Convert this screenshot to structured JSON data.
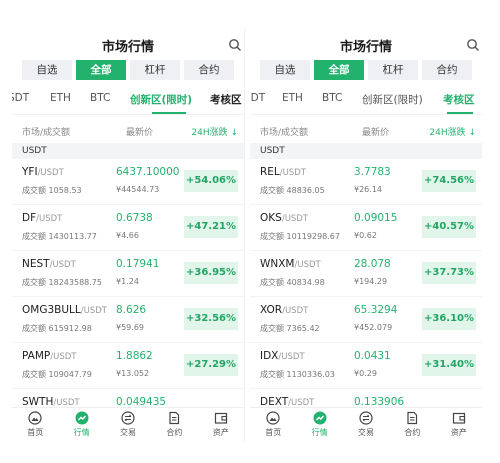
{
  "colors": {
    "accent": "#23b26d",
    "up_bg": "#e2f5ea",
    "up_text": "#23a566"
  },
  "left": {
    "title": "市场行情",
    "segments": [
      "自选",
      "全部",
      "杠杆",
      "合约"
    ],
    "active_segment": "全部",
    "subtabs": [
      "SDT",
      "ETH",
      "BTC",
      "创新区(限时)",
      "考核区"
    ],
    "active_subtab": "创新区(限时)",
    "col_market": "市场/成交额",
    "col_price": "最新价",
    "col_change": "24H涨跌 ↓",
    "group": "USDT",
    "rows": [
      {
        "base": "YFI",
        "quote": "/USDT",
        "vol": "成交额 1058.53",
        "price": "6437.10000",
        "cny": "¥44544.73",
        "change": "+54.06%"
      },
      {
        "base": "DF",
        "quote": "/USDT",
        "vol": "成交额 1430113.77",
        "price": "0.6738",
        "cny": "¥4.66",
        "change": "+47.21%"
      },
      {
        "base": "NEST",
        "quote": "/USDT",
        "vol": "成交额 18243588.75",
        "price": "0.17941",
        "cny": "¥1.24",
        "change": "+36.95%"
      },
      {
        "base": "OMG3BULL",
        "quote": "/USDT",
        "vol": "成交额 615912.98",
        "price": "8.626",
        "cny": "¥59.69",
        "change": "+32.56%"
      },
      {
        "base": "PAMP",
        "quote": "/USDT",
        "vol": "成交额 109047.79",
        "price": "1.8862",
        "cny": "¥13.052",
        "change": "+27.29%"
      },
      {
        "base": "SWTH",
        "quote": "/USDT",
        "vol": "",
        "price": "0.049435",
        "cny": "",
        "change": ""
      }
    ],
    "nav": [
      "首页",
      "行情",
      "交易",
      "合约",
      "资产"
    ],
    "active_nav": "行情"
  },
  "right": {
    "title": "市场行情",
    "segments": [
      "自选",
      "全部",
      "杠杆",
      "合约"
    ],
    "active_segment": "全部",
    "subtabs": [
      "SDT",
      "ETH",
      "BTC",
      "创新区(限时)",
      "考核区"
    ],
    "active_subtab": "考核区",
    "col_market": "市场/成交额",
    "col_price": "最新价",
    "col_change": "24H涨跌 ↓",
    "group": "USDT",
    "rows": [
      {
        "base": "REL",
        "quote": "/USDT",
        "vol": "成交额 48836.05",
        "price": "3.7783",
        "cny": "¥26.14",
        "change": "+74.56%"
      },
      {
        "base": "OKS",
        "quote": "/USDT",
        "vol": "成交额 10119298.67",
        "price": "0.09015",
        "cny": "¥0.62",
        "change": "+40.57%"
      },
      {
        "base": "WNXM",
        "quote": "/USDT",
        "vol": "成交额 40834.98",
        "price": "28.078",
        "cny": "¥194.29",
        "change": "+37.73%"
      },
      {
        "base": "XOR",
        "quote": "/USDT",
        "vol": "成交额 7365.42",
        "price": "65.3294",
        "cny": "¥452.079",
        "change": "+36.10%"
      },
      {
        "base": "IDX",
        "quote": "/USDT",
        "vol": "成交额 1130336.03",
        "price": "0.0431",
        "cny": "¥0.29",
        "change": "+31.40%"
      },
      {
        "base": "DEXT",
        "quote": "/USDT",
        "vol": "",
        "price": "0.133906",
        "cny": "",
        "change": ""
      }
    ],
    "nav": [
      "首页",
      "行情",
      "交易",
      "合约",
      "资产"
    ],
    "active_nav": "行情"
  }
}
